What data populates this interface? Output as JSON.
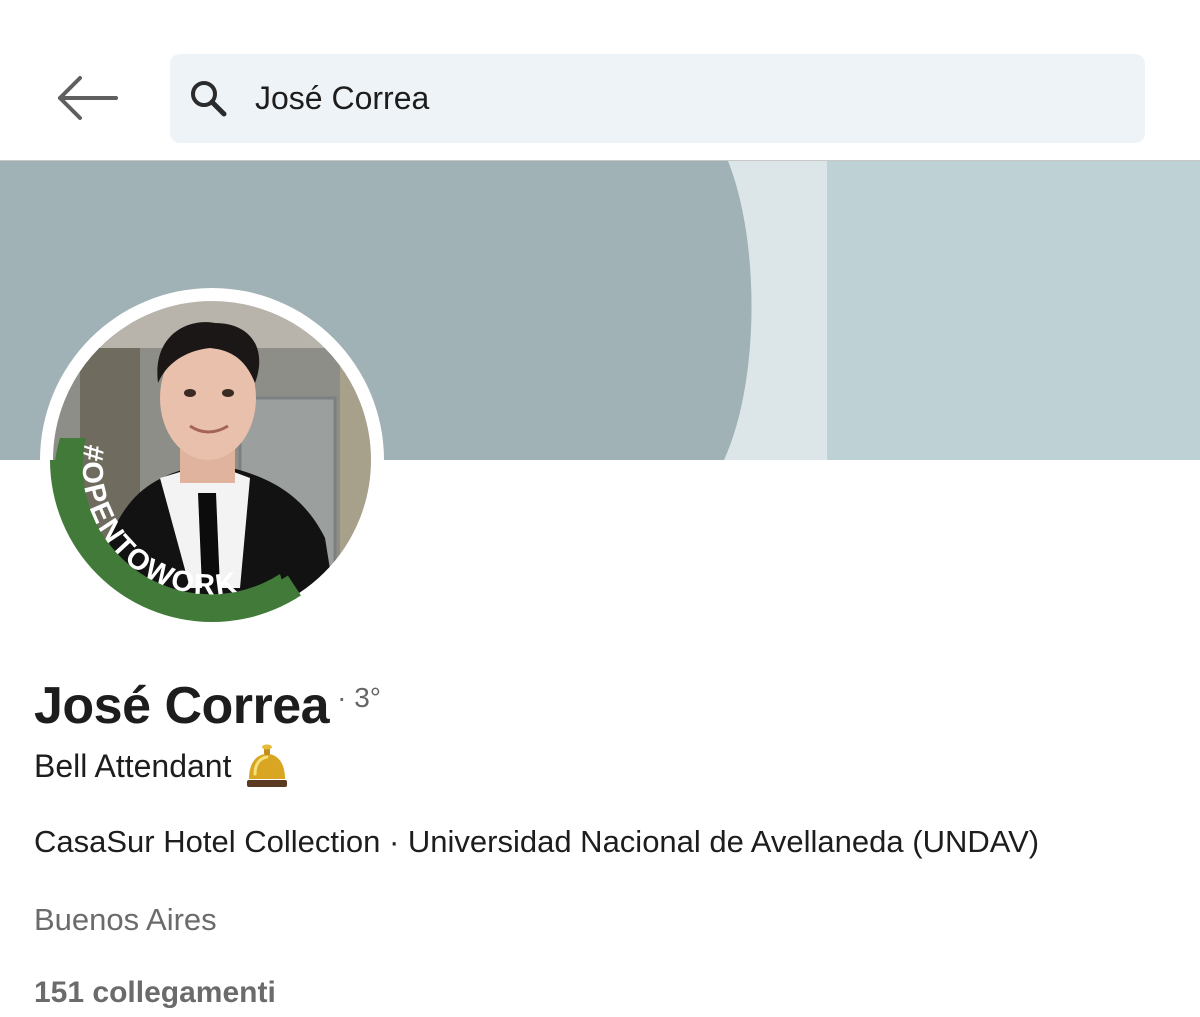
{
  "search": {
    "query": "José Correa",
    "icon": "search-icon"
  },
  "nav": {
    "back_icon": "arrow-left-icon"
  },
  "profile": {
    "name": "José Correa",
    "degree": "· 3°",
    "headline": "Bell Attendant",
    "headline_emoji": "bellhop-bell-icon",
    "company_education": "CasaSur Hotel Collection · Universidad Nacional de Avellaneda (UNDAV)",
    "location": "Buenos Aires",
    "connections": "151 collegamenti",
    "badge_text": "#OPENTOWORK"
  },
  "colors": {
    "banner_dark": "#a0b2b5",
    "banner_light": "#bed2d6",
    "banner_pale": "#dce6e8",
    "open_to_work_green": "#427a3a",
    "search_bg": "#eef3f8"
  }
}
